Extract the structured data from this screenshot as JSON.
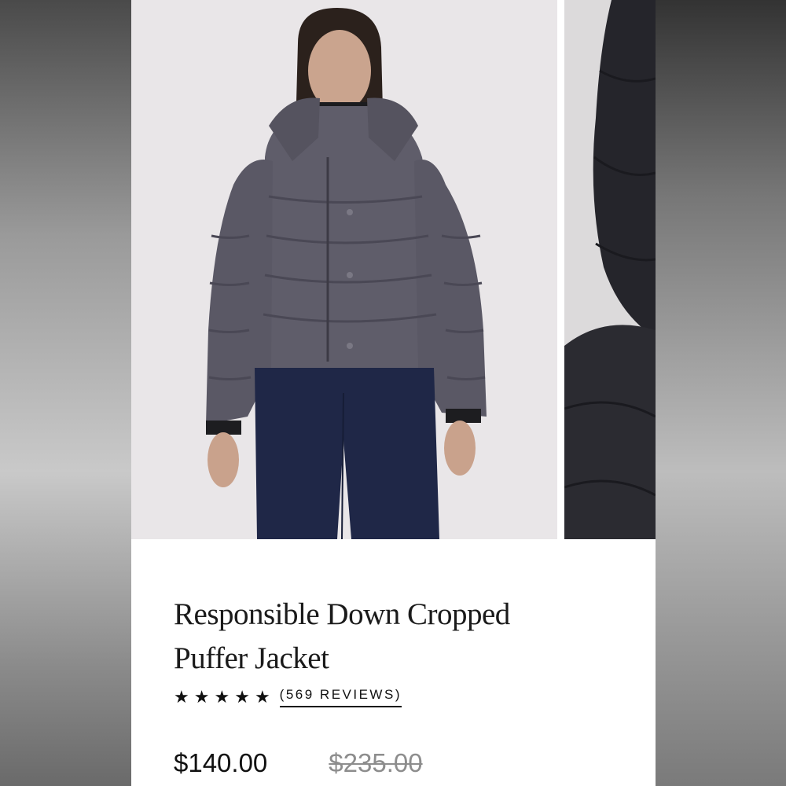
{
  "product": {
    "title_line1": "Responsible Down Cropped",
    "title_line2": "Puffer Jacket",
    "rating_stars": 5,
    "reviews_text": "(569 REVIEWS)",
    "price": "$140.00",
    "original_price": "$235.00"
  },
  "gallery": {
    "images": [
      "model-front-photo",
      "hood-detail-photo"
    ]
  },
  "colors": {
    "jacket": "#5f5d6a",
    "pants": "#1f2747",
    "background": "#e9e6e8",
    "text": "#111111",
    "strike_price": "#8d8d8d"
  }
}
